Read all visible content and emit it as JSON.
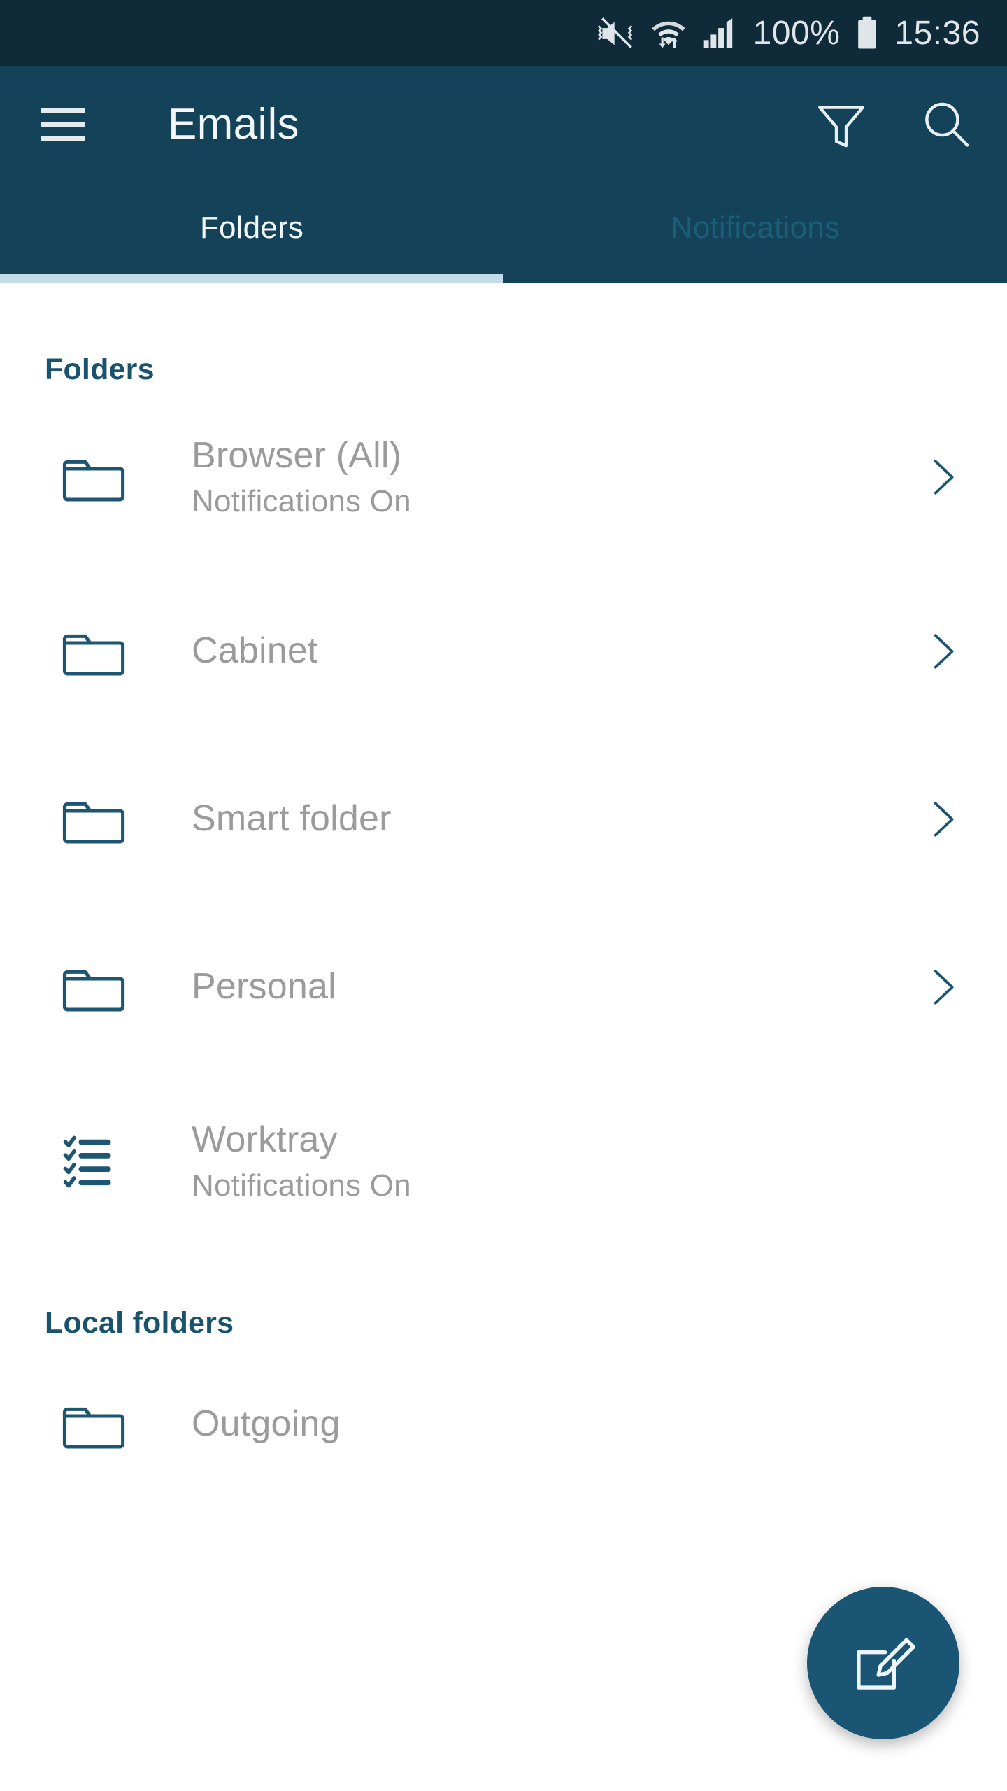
{
  "status_bar": {
    "battery_percent": "100%",
    "time": "15:36",
    "icons": [
      "mute-vibrate-icon",
      "wifi-icon",
      "cellular-signal-icon",
      "battery-icon"
    ]
  },
  "app_bar": {
    "title": "Emails",
    "menu_icon": "hamburger-menu-icon",
    "filter_icon": "filter-funnel-icon",
    "search_icon": "search-icon"
  },
  "tabs": [
    {
      "label": "Folders",
      "active": true
    },
    {
      "label": "Notifications",
      "active": false
    }
  ],
  "sections": [
    {
      "title": "Folders",
      "items": [
        {
          "title": "Browser (All)",
          "subtitle": "Notifications On",
          "icon": "folder-icon",
          "chevron": true
        },
        {
          "title": "Cabinet",
          "subtitle": "",
          "icon": "folder-icon",
          "chevron": true
        },
        {
          "title": "Smart folder",
          "subtitle": "",
          "icon": "folder-icon",
          "chevron": true
        },
        {
          "title": "Personal",
          "subtitle": "",
          "icon": "folder-icon",
          "chevron": true
        },
        {
          "title": "Worktray",
          "subtitle": "Notifications On",
          "icon": "checklist-icon",
          "chevron": false
        }
      ]
    },
    {
      "title": "Local folders",
      "items": [
        {
          "title": "Outgoing",
          "subtitle": "",
          "icon": "folder-icon",
          "chevron": false
        }
      ]
    }
  ],
  "fab": {
    "icon": "compose-edit-icon",
    "label": "Compose"
  },
  "colors": {
    "status_bar_bg": "#0f2a39",
    "app_bar_bg": "#134259",
    "tab_indicator": "#c3dbe8",
    "section_title": "#1a5370",
    "row_text": "#9b9b9b",
    "icon_stroke": "#1d5673",
    "fab_bg": "#1a5573",
    "inactive_tab_text": "#1b5e78"
  }
}
